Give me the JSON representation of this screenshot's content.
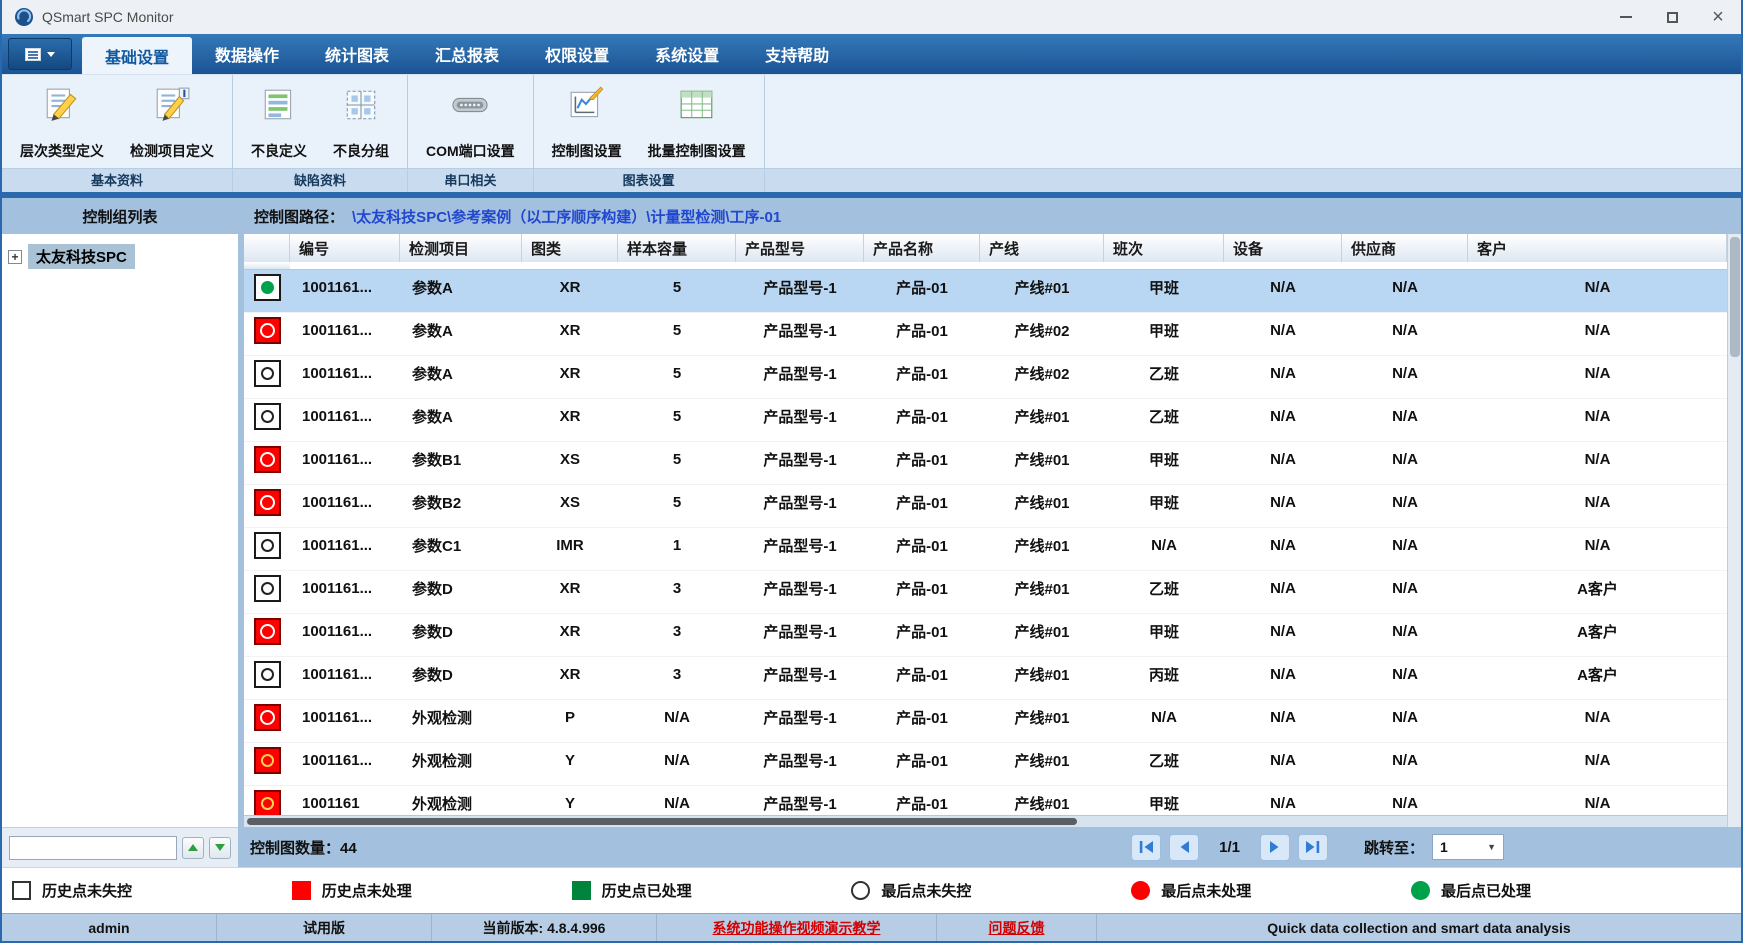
{
  "window": {
    "title": "QSmart SPC Monitor"
  },
  "colors": {
    "status_red": "#fe0000",
    "status_green": "#00a14b",
    "accent_blue": "#1f62ab",
    "selected_row": "#b9d7f2",
    "path_text": "#2247cf",
    "link_red": "#d40000"
  },
  "icons": {
    "chevron_down": "▼",
    "close": "×",
    "tree_expander": "+"
  },
  "ribbon": {
    "tabs": [
      {
        "id": "basic-settings",
        "label": "基础设置",
        "active": true
      },
      {
        "id": "data-operations",
        "label": "数据操作",
        "active": false
      },
      {
        "id": "statistical-charts",
        "label": "统计图表",
        "active": false
      },
      {
        "id": "summary-reports",
        "label": "汇总报表",
        "active": false
      },
      {
        "id": "permission-settings",
        "label": "权限设置",
        "active": false
      },
      {
        "id": "system-settings",
        "label": "系统设置",
        "active": false
      },
      {
        "id": "support-help",
        "label": "支持帮助",
        "active": false
      }
    ],
    "groups": [
      {
        "label": "基本资料",
        "buttons": [
          {
            "label": "层次类型定义",
            "icon": "hierarchy-type-define-icon"
          },
          {
            "label": "检测项目定义",
            "icon": "inspection-item-define-icon"
          }
        ]
      },
      {
        "label": "缺陷资料",
        "buttons": [
          {
            "label": "不良定义",
            "icon": "defect-define-icon"
          },
          {
            "label": "不良分组",
            "icon": "defect-group-icon"
          }
        ]
      },
      {
        "label": "串口相关",
        "buttons": [
          {
            "label": "COM端口设置",
            "icon": "com-port-setup-icon"
          }
        ]
      },
      {
        "label": "图表设置",
        "buttons": [
          {
            "label": "控制图设置",
            "icon": "control-chart-setup-icon"
          },
          {
            "label": "批量控制图设置",
            "icon": "batch-control-chart-setup-icon"
          }
        ]
      }
    ]
  },
  "sidebar": {
    "header": "控制组列表",
    "search_value": "",
    "tree": [
      {
        "label": "太友科技SPC",
        "expanded": false
      }
    ]
  },
  "path_bar": {
    "label": "控制图路径：",
    "path": "\\太友科技SPC\\参考案例（以工序顺序构建）\\计量型检测\\工序-01"
  },
  "table": {
    "columns": [
      {
        "key": "status",
        "label": ""
      },
      {
        "key": "code",
        "label": "编号"
      },
      {
        "key": "item",
        "label": "检测项目"
      },
      {
        "key": "chart-type",
        "label": "图类"
      },
      {
        "key": "sample-size",
        "label": "样本容量"
      },
      {
        "key": "product-model",
        "label": "产品型号"
      },
      {
        "key": "product-name",
        "label": "产品名称"
      },
      {
        "key": "line",
        "label": "产线"
      },
      {
        "key": "shift",
        "label": "班次"
      },
      {
        "key": "device",
        "label": "设备"
      },
      {
        "key": "supplier",
        "label": "供应商"
      },
      {
        "key": "customer",
        "label": "客户"
      }
    ],
    "rows": [
      {
        "selected": true,
        "history": "in-control",
        "last": "processed",
        "cells": [
          "1001161...",
          "参数A",
          "XR",
          "5",
          "产品型号-1",
          "产品-01",
          "产线#01",
          "甲班",
          "N/A",
          "N/A",
          "N/A"
        ]
      },
      {
        "selected": false,
        "history": "unprocessed",
        "last": "unprocessed",
        "cells": [
          "1001161...",
          "参数A",
          "XR",
          "5",
          "产品型号-1",
          "产品-01",
          "产线#02",
          "甲班",
          "N/A",
          "N/A",
          "N/A"
        ]
      },
      {
        "selected": false,
        "history": "in-control",
        "last": "in-control",
        "cells": [
          "1001161...",
          "参数A",
          "XR",
          "5",
          "产品型号-1",
          "产品-01",
          "产线#02",
          "乙班",
          "N/A",
          "N/A",
          "N/A"
        ]
      },
      {
        "selected": false,
        "history": "in-control",
        "last": "in-control",
        "cells": [
          "1001161...",
          "参数A",
          "XR",
          "5",
          "产品型号-1",
          "产品-01",
          "产线#01",
          "乙班",
          "N/A",
          "N/A",
          "N/A"
        ]
      },
      {
        "selected": false,
        "history": "unprocessed",
        "last": "unprocessed",
        "cells": [
          "1001161...",
          "参数B1",
          "XS",
          "5",
          "产品型号-1",
          "产品-01",
          "产线#01",
          "甲班",
          "N/A",
          "N/A",
          "N/A"
        ]
      },
      {
        "selected": false,
        "history": "unprocessed",
        "last": "unprocessed",
        "cells": [
          "1001161...",
          "参数B2",
          "XS",
          "5",
          "产品型号-1",
          "产品-01",
          "产线#01",
          "甲班",
          "N/A",
          "N/A",
          "N/A"
        ]
      },
      {
        "selected": false,
        "history": "in-control",
        "last": "in-control",
        "cells": [
          "1001161...",
          "参数C1",
          "IMR",
          "1",
          "产品型号-1",
          "产品-01",
          "产线#01",
          "N/A",
          "N/A",
          "N/A",
          "N/A"
        ]
      },
      {
        "selected": false,
        "history": "in-control",
        "last": "in-control",
        "cells": [
          "1001161...",
          "参数D",
          "XR",
          "3",
          "产品型号-1",
          "产品-01",
          "产线#01",
          "乙班",
          "N/A",
          "N/A",
          "A客户"
        ]
      },
      {
        "selected": false,
        "history": "unprocessed",
        "last": "unprocessed",
        "cells": [
          "1001161...",
          "参数D",
          "XR",
          "3",
          "产品型号-1",
          "产品-01",
          "产线#01",
          "甲班",
          "N/A",
          "N/A",
          "A客户"
        ]
      },
      {
        "selected": false,
        "history": "in-control",
        "last": "in-control",
        "cells": [
          "1001161...",
          "参数D",
          "XR",
          "3",
          "产品型号-1",
          "产品-01",
          "产线#01",
          "丙班",
          "N/A",
          "N/A",
          "A客户"
        ]
      },
      {
        "selected": false,
        "history": "unprocessed",
        "last": "unprocessed",
        "cells": [
          "1001161...",
          "外观检测",
          "P",
          "N/A",
          "产品型号-1",
          "产品-01",
          "产线#01",
          "N/A",
          "N/A",
          "N/A",
          "N/A"
        ]
      },
      {
        "selected": false,
        "history": "unprocessed",
        "last": "in-control",
        "cells": [
          "1001161...",
          "外观检测",
          "Y",
          "N/A",
          "产品型号-1",
          "产品-01",
          "产线#01",
          "乙班",
          "N/A",
          "N/A",
          "N/A"
        ]
      },
      {
        "selected": false,
        "history": "unprocessed",
        "last": "in-control",
        "cells": [
          "1001161",
          "外观检测",
          "Y",
          "N/A",
          "产品型号-1",
          "产品-01",
          "产线#01",
          "甲班",
          "N/A",
          "N/A",
          "N/A"
        ]
      }
    ]
  },
  "pagination": {
    "count_label": "控制图数量：",
    "count_value": "44",
    "page_indicator": "1/1",
    "jump_label": "跳转至：",
    "jump_value": "1"
  },
  "legend": [
    {
      "label": "历史点未失控",
      "swatch": "square-white"
    },
    {
      "label": "历史点未处理",
      "swatch": "square-red"
    },
    {
      "label": "历史点已处理",
      "swatch": "square-green"
    },
    {
      "label": "最后点未失控",
      "swatch": "circle-white"
    },
    {
      "label": "最后点未处理",
      "swatch": "circle-red"
    },
    {
      "label": "最后点已处理",
      "swatch": "circle-green"
    }
  ],
  "status_bar": {
    "user": "admin",
    "edition": "试用版",
    "version": "当前版本: 4.8.4.996",
    "video_link": "系统功能操作视频演示教学",
    "feedback_link": "问题反馈",
    "slogan": "Quick data collection and smart data analysis"
  }
}
